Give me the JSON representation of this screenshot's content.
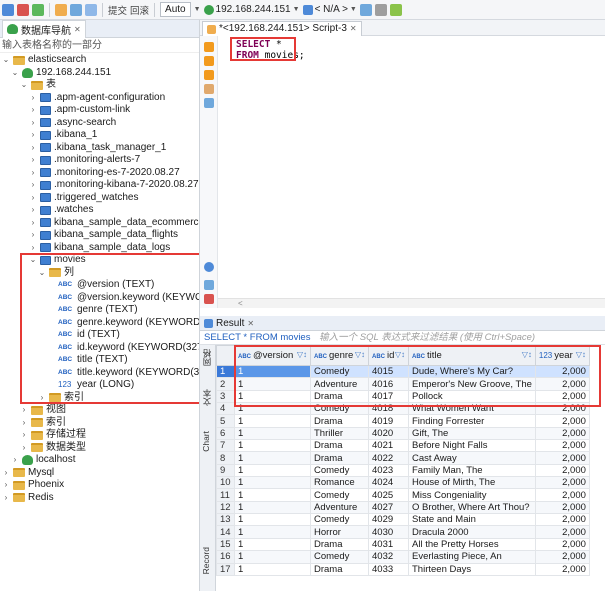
{
  "toolbar": {
    "commit": "提交",
    "rollback": "回滚",
    "mode": "Auto",
    "connection": "192.168.244.151",
    "schema": "< N/A >"
  },
  "navigator": {
    "tab_title": "数据库导航",
    "filter_placeholder": "输入表格名称的一部分",
    "tree": [
      {
        "label": "elasticsearch",
        "icon": "folder",
        "level": 0,
        "expanded": true
      },
      {
        "label": "192.168.244.151",
        "icon": "database",
        "level": 1,
        "expanded": true
      },
      {
        "label": "表",
        "icon": "folder",
        "level": 2,
        "expanded": true
      },
      {
        "label": ".apm-agent-configuration",
        "icon": "table",
        "level": 3
      },
      {
        "label": ".apm-custom-link",
        "icon": "table",
        "level": 3
      },
      {
        "label": ".async-search",
        "icon": "table",
        "level": 3
      },
      {
        "label": ".kibana_1",
        "icon": "table",
        "level": 3
      },
      {
        "label": ".kibana_task_manager_1",
        "icon": "table",
        "level": 3
      },
      {
        "label": ".monitoring-alerts-7",
        "icon": "table",
        "level": 3
      },
      {
        "label": ".monitoring-es-7-2020.08.27",
        "icon": "table",
        "level": 3
      },
      {
        "label": ".monitoring-kibana-7-2020.08.27",
        "icon": "table",
        "level": 3
      },
      {
        "label": ".triggered_watches",
        "icon": "table",
        "level": 3
      },
      {
        "label": ".watches",
        "icon": "table",
        "level": 3
      },
      {
        "label": "kibana_sample_data_ecommerce",
        "icon": "table",
        "level": 3
      },
      {
        "label": "kibana_sample_data_flights",
        "icon": "table",
        "level": 3
      },
      {
        "label": "kibana_sample_data_logs",
        "icon": "table",
        "level": 3
      },
      {
        "label": "movies",
        "icon": "table",
        "level": 3,
        "expanded": true
      },
      {
        "label": "列",
        "icon": "folder",
        "level": 4,
        "expanded": true
      },
      {
        "label": "@version (TEXT)",
        "icon": "col",
        "level": 5
      },
      {
        "label": "@version.keyword (KEYWORD(327",
        "icon": "col",
        "level": 5
      },
      {
        "label": "genre (TEXT)",
        "icon": "col",
        "level": 5
      },
      {
        "label": "genre.keyword (KEYWORD(32766))",
        "icon": "col",
        "level": 5
      },
      {
        "label": "id (TEXT)",
        "icon": "col",
        "level": 5
      },
      {
        "label": "id.keyword (KEYWORD(32766))",
        "icon": "col",
        "level": 5
      },
      {
        "label": "title (TEXT)",
        "icon": "col",
        "level": 5
      },
      {
        "label": "title.keyword (KEYWORD(32766))",
        "icon": "col",
        "level": 5
      },
      {
        "label": "year (LONG)",
        "icon": "num",
        "level": 5
      },
      {
        "label": "索引",
        "icon": "folder",
        "level": 4
      },
      {
        "label": "视图",
        "icon": "folder",
        "level": 2
      },
      {
        "label": "索引",
        "icon": "folder",
        "level": 2
      },
      {
        "label": "存储过程",
        "icon": "folder",
        "level": 2
      },
      {
        "label": "数据类型",
        "icon": "folder",
        "level": 2
      },
      {
        "label": "localhost",
        "icon": "database",
        "level": 1
      },
      {
        "label": "Mysql",
        "icon": "folder",
        "level": 0
      },
      {
        "label": "Phoenix",
        "icon": "folder",
        "level": 0
      },
      {
        "label": "Redis",
        "icon": "folder",
        "level": 0
      }
    ]
  },
  "editor": {
    "tab_title": "*<192.168.244.151> Script-3",
    "code_line1_kw": "SELECT",
    "code_line1_rest": " *",
    "code_line2_kw": "FROM",
    "code_line2_rest": " movies;"
  },
  "result": {
    "tab_title": "Result",
    "query_label": "SELECT * FROM movies",
    "filter_placeholder": "输入一个 SQL 表达式来过滤结果 (使用 Ctrl+Space)",
    "side_labels": [
      "网格",
      "文本",
      "Chart",
      "Record"
    ],
    "columns": [
      {
        "type": "ABC",
        "name": "@version"
      },
      {
        "type": "ABC",
        "name": "genre"
      },
      {
        "type": "ABC",
        "name": "id"
      },
      {
        "type": "ABC",
        "name": "title"
      },
      {
        "type": "123",
        "name": "year"
      }
    ],
    "rows": [
      [
        "1",
        "1",
        "Comedy",
        "4015",
        "Dude, Where's My Car?",
        "2,000"
      ],
      [
        "2",
        "1",
        "Adventure",
        "4016",
        "Emperor's New Groove, The",
        "2,000"
      ],
      [
        "3",
        "1",
        "Drama",
        "4017",
        "Pollock",
        "2,000"
      ],
      [
        "4",
        "1",
        "Comedy",
        "4018",
        "What Women Want",
        "2,000"
      ],
      [
        "5",
        "1",
        "Drama",
        "4019",
        "Finding Forrester",
        "2,000"
      ],
      [
        "6",
        "1",
        "Thriller",
        "4020",
        "Gift, The",
        "2,000"
      ],
      [
        "7",
        "1",
        "Drama",
        "4021",
        "Before Night Falls",
        "2,000"
      ],
      [
        "8",
        "1",
        "Drama",
        "4022",
        "Cast Away",
        "2,000"
      ],
      [
        "9",
        "1",
        "Comedy",
        "4023",
        "Family Man, The",
        "2,000"
      ],
      [
        "10",
        "1",
        "Romance",
        "4024",
        "House of Mirth, The",
        "2,000"
      ],
      [
        "11",
        "1",
        "Comedy",
        "4025",
        "Miss Congeniality",
        "2,000"
      ],
      [
        "12",
        "1",
        "Adventure",
        "4027",
        "O Brother, Where Art Thou?",
        "2,000"
      ],
      [
        "13",
        "1",
        "Comedy",
        "4029",
        "State and Main",
        "2,000"
      ],
      [
        "14",
        "1",
        "Horror",
        "4030",
        "Dracula 2000",
        "2,000"
      ],
      [
        "15",
        "1",
        "Drama",
        "4031",
        "All the Pretty Horses",
        "2,000"
      ],
      [
        "16",
        "1",
        "Comedy",
        "4032",
        "Everlasting Piece, An",
        "2,000"
      ],
      [
        "17",
        "1",
        "Drama",
        "4033",
        "Thirteen Days",
        "2,000"
      ]
    ]
  }
}
